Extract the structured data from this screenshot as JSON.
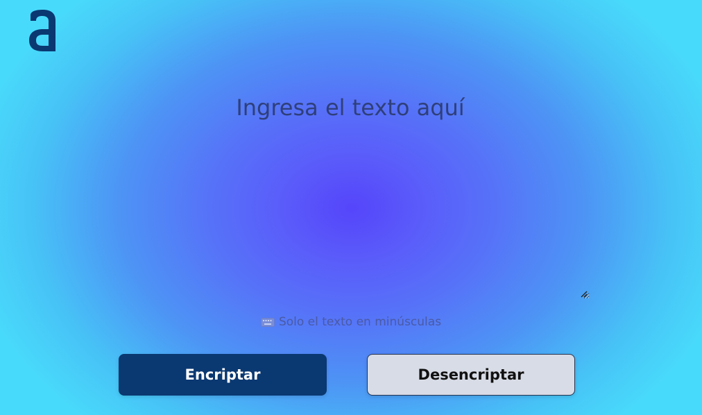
{
  "app": {
    "logo_icon": "alura-a-logo",
    "logo_color": "#0a3871"
  },
  "input": {
    "placeholder": "Ingresa el texto aquí",
    "value": ""
  },
  "hint": {
    "icon": "keyboard-icon",
    "text": "Solo el texto en minúsculas"
  },
  "actions": {
    "encrypt_label": "Encriptar",
    "decrypt_label": "Desencriptar"
  },
  "colors": {
    "primary": "#0a3871",
    "secondary": "#d8dce6",
    "background_center": "#5545fb",
    "background_edge": "#48dafb"
  }
}
